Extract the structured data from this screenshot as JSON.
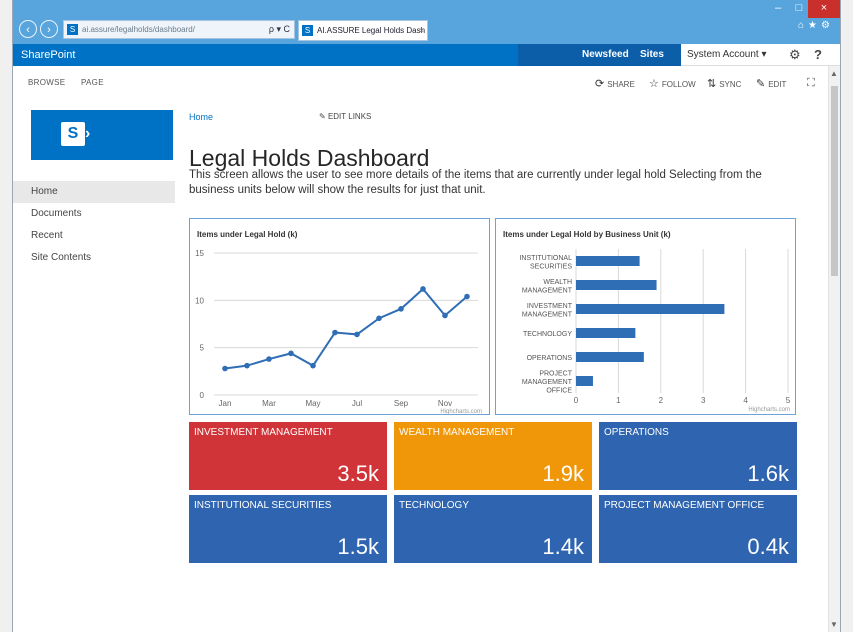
{
  "browser": {
    "address": "ai.assure/legalholds/dashboard/",
    "address_tools": "ρ ▾ C",
    "tab_title": "AI.ASSURE Legal Holds Dash",
    "tab_close": "×",
    "back": "‹",
    "forward": "›"
  },
  "suite": {
    "brand": "SharePoint",
    "newsfeed": "Newsfeed",
    "sites": "Sites",
    "account": "System Account ▾",
    "gear": "⚙",
    "help": "?"
  },
  "ribbon": {
    "tabs": [
      "BROWSE",
      "PAGE"
    ],
    "actions": {
      "share": "SHARE",
      "follow": "FOLLOW",
      "sync": "SYNC",
      "edit": "EDIT"
    }
  },
  "nav": {
    "items": [
      "Home",
      "Documents",
      "Recent",
      "Site Contents"
    ]
  },
  "breadcrumb": {
    "home": "Home",
    "edit_links": "EDIT LINKS"
  },
  "page": {
    "title": "Legal Holds Dashboard",
    "description": "This screen allows the user to see more details of the items that are currently under legal hold Selecting from the business units below will show the results for just that unit."
  },
  "charts": {
    "line": {
      "title": "Items under Legal Hold (k)",
      "credit": "Highcharts.com",
      "y_ticks": [
        "0",
        "5",
        "10",
        "15"
      ],
      "x_ticks": [
        "Jan",
        "Mar",
        "May",
        "Jul",
        "Sep",
        "Nov"
      ]
    },
    "bar": {
      "title": "Items under Legal Hold by Business Unit (k)",
      "credit": "Highcharts.com",
      "x_ticks": [
        "0",
        "1",
        "2",
        "3",
        "4",
        "5"
      ],
      "categories": [
        [
          "INSTITUTIONAL",
          "SECURITIES"
        ],
        [
          "WEALTH",
          "MANAGEMENT"
        ],
        [
          "INVESTMENT",
          "MANAGEMENT"
        ],
        [
          "TECHNOLOGY"
        ],
        [
          "OPERATIONS"
        ],
        [
          "PROJECT",
          "MANAGEMENT",
          "OFFICE"
        ]
      ]
    }
  },
  "chart_data": [
    {
      "type": "line",
      "title": "Items under Legal Hold (k)",
      "categories": [
        "Jan",
        "Feb",
        "Mar",
        "Apr",
        "May",
        "Jun",
        "Jul",
        "Aug",
        "Sep",
        "Oct",
        "Nov",
        "Dec"
      ],
      "values": [
        2.8,
        3.1,
        3.8,
        4.4,
        3.1,
        6.6,
        6.4,
        8.1,
        9.1,
        11.2,
        8.4,
        10.4
      ],
      "ylim": [
        0,
        15
      ],
      "grid": true,
      "color": "#2f6db5"
    },
    {
      "type": "bar",
      "orientation": "horizontal",
      "title": "Items under Legal Hold by Business Unit (k)",
      "categories": [
        "INSTITUTIONAL SECURITIES",
        "WEALTH MANAGEMENT",
        "INVESTMENT MANAGEMENT",
        "TECHNOLOGY",
        "OPERATIONS",
        "PROJECT MANAGEMENT OFFICE"
      ],
      "values": [
        1.5,
        1.9,
        3.5,
        1.4,
        1.6,
        0.4
      ],
      "xlim": [
        0,
        5
      ],
      "grid": true,
      "color": "#2f6db5"
    }
  ],
  "tiles": [
    {
      "label": "INVESTMENT MANAGEMENT",
      "value": "3.5k",
      "color": "#d13438"
    },
    {
      "label": "WEALTH MANAGEMENT",
      "value": "1.9k",
      "color": "#f09609"
    },
    {
      "label": "OPERATIONS",
      "value": "1.6k",
      "color": "#2e64b0"
    },
    {
      "label": "INSTITUTIONAL SECURITIES",
      "value": "1.5k",
      "color": "#2e64b0"
    },
    {
      "label": "TECHNOLOGY",
      "value": "1.4k",
      "color": "#2e64b0"
    },
    {
      "label": "PROJECT MANAGEMENT OFFICE",
      "value": "0.4k",
      "color": "#2e64b0"
    }
  ]
}
